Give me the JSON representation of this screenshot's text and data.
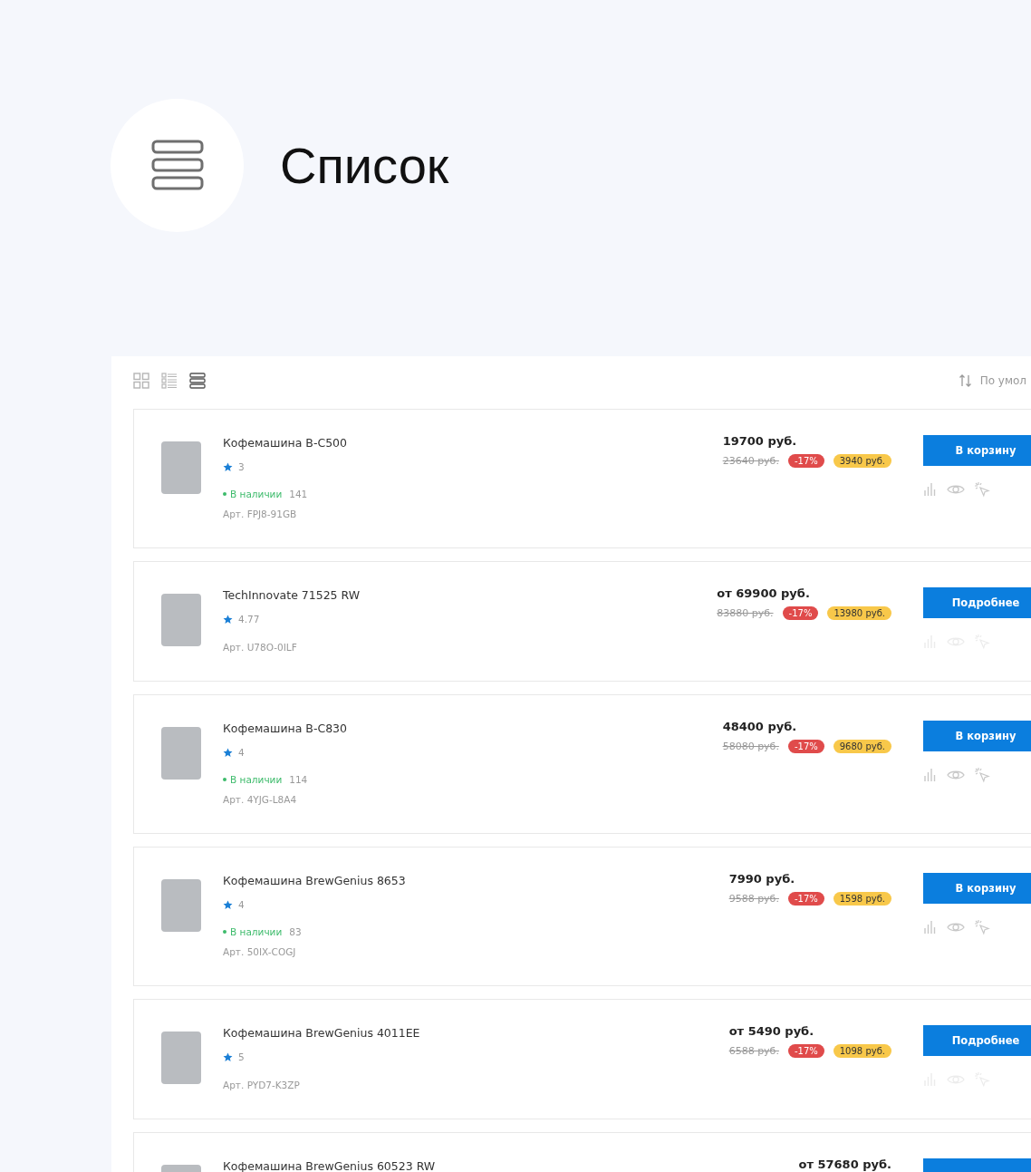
{
  "header": {
    "title": "Список"
  },
  "toolbar": {
    "view_modes": [
      {
        "kind": "tile",
        "selected": false
      },
      {
        "kind": "detailed",
        "selected": false
      },
      {
        "kind": "list",
        "selected": true
      }
    ],
    "sort": {
      "label": "По умол"
    }
  },
  "products": [
    {
      "name": "Кофемашина B-C500",
      "rating": "3",
      "stock": {
        "label": "В наличии",
        "count": "141"
      },
      "article": "Арт. FPJ8-91GB",
      "price": "19700 руб.",
      "old_price": "23640 руб.",
      "discount": "-17%",
      "saving": "3940 руб.",
      "button": "В корзину",
      "actions_disabled": false
    },
    {
      "name": "TechInnovate 71525 RW",
      "rating": "4.77",
      "article": "Арт. U78O-0ILF",
      "price": "от 69900 руб.",
      "old_price": "83880 руб.",
      "discount": "-17%",
      "saving": "13980 руб.",
      "button": "Подробнее",
      "actions_disabled": true
    },
    {
      "name": "Кофемашина B-C830",
      "rating": "4",
      "stock": {
        "label": "В наличии",
        "count": "114"
      },
      "article": "Арт. 4YJG-L8A4",
      "price": "48400 руб.",
      "old_price": "58080 руб.",
      "discount": "-17%",
      "saving": "9680 руб.",
      "button": "В корзину",
      "actions_disabled": false
    },
    {
      "name": "Кофемашина BrewGenius 8653",
      "rating": "4",
      "stock": {
        "label": "В наличии",
        "count": "83"
      },
      "article": "Арт. 50IX-COGJ",
      "price": "7990 руб.",
      "old_price": "9588 руб.",
      "discount": "-17%",
      "saving": "1598 руб.",
      "button": "В корзину",
      "actions_disabled": false
    },
    {
      "name": "Кофемашина BrewGenius 4011EE",
      "rating": "5",
      "article": "Арт. PYD7-K3ZP",
      "price": "от 5490 руб.",
      "old_price": "6588 руб.",
      "discount": "-17%",
      "saving": "1098 руб.",
      "button": "Подробнее",
      "actions_disabled": true
    },
    {
      "name": "Кофемашина BrewGenius 60523 RW",
      "price": "от 57680 руб."
    }
  ]
}
